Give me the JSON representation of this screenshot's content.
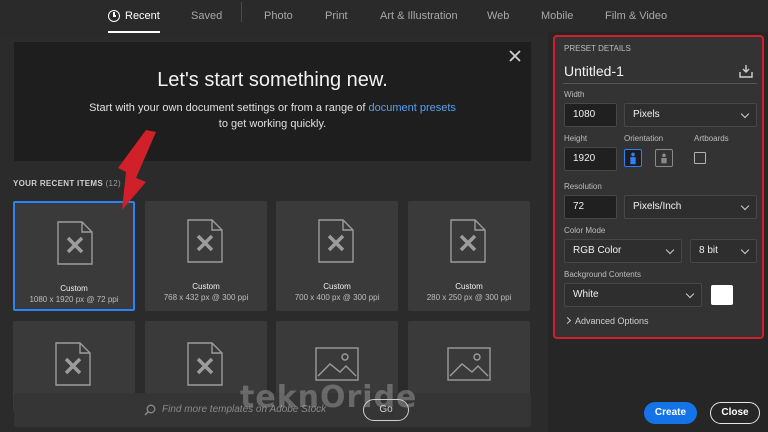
{
  "tabs": [
    {
      "label": "Recent",
      "active": true
    },
    {
      "label": "Saved",
      "active": false
    },
    {
      "label": "Photo",
      "active": false
    },
    {
      "label": "Print",
      "active": false
    },
    {
      "label": "Art & Illustration",
      "active": false
    },
    {
      "label": "Web",
      "active": false
    },
    {
      "label": "Mobile",
      "active": false
    },
    {
      "label": "Film & Video",
      "active": false
    }
  ],
  "hero": {
    "title": "Let's start something new.",
    "line1_prefix": "Start with your own document settings or from a range of ",
    "line1_link": "document presets",
    "line2": "to get working quickly."
  },
  "recent": {
    "label": "YOUR RECENT ITEMS",
    "count": "(12)",
    "items": [
      {
        "name": "Custom",
        "dims": "1080 x 1920 px @ 72 ppi",
        "selected": true
      },
      {
        "name": "Custom",
        "dims": "768 x 432 px @ 300 ppi",
        "selected": false
      },
      {
        "name": "Custom",
        "dims": "700 x 400 px @ 300 ppi",
        "selected": false
      },
      {
        "name": "Custom",
        "dims": "280 x 250 px @ 300 ppi",
        "selected": false
      }
    ]
  },
  "search": {
    "placeholder": "Find more templates on Adobe Stock",
    "go_label": "Go"
  },
  "preset": {
    "header": "PRESET DETAILS",
    "name": "Untitled-1",
    "width_label": "Width",
    "width_value": "1080",
    "width_unit": "Pixels",
    "height_label": "Height",
    "height_value": "1920",
    "orientation_label": "Orientation",
    "artboards_label": "Artboards",
    "resolution_label": "Resolution",
    "resolution_value": "72",
    "resolution_unit": "Pixels/Inch",
    "color_mode_label": "Color Mode",
    "color_mode_value": "RGB Color",
    "bit_depth": "8 bit",
    "background_label": "Background Contents",
    "background_value": "White",
    "advanced_label": "Advanced Options"
  },
  "actions": {
    "create_label": "Create",
    "close_label": "Close"
  },
  "watermark": "teknOride",
  "colors": {
    "accent": "#1473e6",
    "highlight": "#d0202a",
    "link": "#5aa0ef"
  }
}
